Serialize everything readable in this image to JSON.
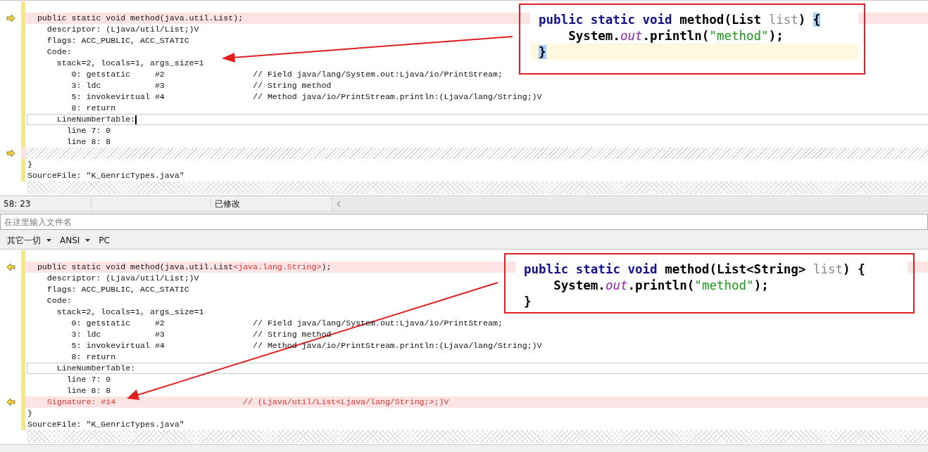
{
  "top_pane": {
    "marker_left": false,
    "lines": [
      {
        "kind": "blank",
        "changed": false
      },
      {
        "kind": "code",
        "changed": true,
        "parts": [
          {
            "text": "  public static void method(java.util.List);",
            "changed": false
          }
        ]
      },
      {
        "kind": "code",
        "changed": false,
        "parts": [
          {
            "text": "    descriptor: (Ljava/util/List;)V",
            "changed": false
          }
        ]
      },
      {
        "kind": "code",
        "changed": false,
        "parts": [
          {
            "text": "    flags: ACC_PUBLIC, ACC_STATIC",
            "changed": false
          }
        ]
      },
      {
        "kind": "code",
        "changed": false,
        "parts": [
          {
            "text": "    Code:",
            "changed": false
          }
        ]
      },
      {
        "kind": "code",
        "changed": false,
        "parts": [
          {
            "text": "      stack=2, locals=1, args_size=1",
            "changed": false
          }
        ]
      },
      {
        "kind": "code",
        "changed": false,
        "parts": [
          {
            "text": "         0: getstatic     #2                  // Field java/lang/System.out:Ljava/io/PrintStream;",
            "changed": false
          }
        ]
      },
      {
        "kind": "code",
        "changed": false,
        "parts": [
          {
            "text": "         3: ldc           #3                  // String method",
            "changed": false
          }
        ]
      },
      {
        "kind": "code",
        "changed": false,
        "parts": [
          {
            "text": "         5: invokevirtual #4                  // Method java/io/PrintStream.println:(Ljava/lang/String;)V",
            "changed": false
          }
        ]
      },
      {
        "kind": "code",
        "changed": false,
        "parts": [
          {
            "text": "         8: return",
            "changed": false
          }
        ]
      },
      {
        "kind": "code",
        "changed": false,
        "boxed": true,
        "cursor": true,
        "parts": [
          {
            "text": "      LineNumberTable:",
            "changed": false
          }
        ]
      },
      {
        "kind": "code",
        "changed": false,
        "parts": [
          {
            "text": "        line 7: 0",
            "changed": false
          }
        ]
      },
      {
        "kind": "code",
        "changed": false,
        "parts": [
          {
            "text": "        line 8: 8",
            "changed": false
          }
        ]
      },
      {
        "kind": "hatch",
        "changed": true
      },
      {
        "kind": "code",
        "changed": false,
        "parts": [
          {
            "text": "}",
            "changed": false
          }
        ]
      },
      {
        "kind": "code",
        "changed": false,
        "parts": [
          {
            "text": "SourceFile: \"K_GenricTypes.java\"",
            "changed": false
          }
        ]
      }
    ],
    "callout": {
      "lines": [
        {
          "current": false,
          "tokens": [
            {
              "kind": "keyword",
              "text": "public static void"
            },
            {
              "kind": "plain",
              "text": " method(List "
            },
            {
              "kind": "param",
              "text": "list"
            },
            {
              "kind": "plain",
              "text": ") "
            },
            {
              "kind": "plain",
              "text": "{",
              "highlighted": true
            }
          ]
        },
        {
          "current": false,
          "tokens": [
            {
              "kind": "plain",
              "text": "    System."
            },
            {
              "kind": "field",
              "text": "out"
            },
            {
              "kind": "plain",
              "text": ".println("
            },
            {
              "kind": "string",
              "text": "\"method\""
            },
            {
              "kind": "plain",
              "text": ");"
            }
          ]
        },
        {
          "current": true,
          "tokens": [
            {
              "kind": "plain",
              "text": "}",
              "highlighted": true
            }
          ]
        }
      ]
    }
  },
  "status_bar": {
    "position": "58: 23",
    "state": "已修改"
  },
  "filename_field": {
    "placeholder": "在这里输入文件名"
  },
  "toolbar": [
    {
      "label": "其它一切",
      "dropdown": true
    },
    {
      "label": "ANSI",
      "dropdown": true
    },
    {
      "label": "PC",
      "dropdown": false
    }
  ],
  "bottom_pane": {
    "marker_left": true,
    "lines": [
      {
        "kind": "blank",
        "changed": false
      },
      {
        "kind": "code",
        "changed": true,
        "parts": [
          {
            "text": "  public static void method(java.util.List",
            "changed": false
          },
          {
            "text": "<java.lang.String>",
            "changed": true
          },
          {
            "text": ");",
            "changed": false
          }
        ]
      },
      {
        "kind": "code",
        "changed": false,
        "parts": [
          {
            "text": "    descriptor: (Ljava/util/List;)V",
            "changed": false
          }
        ]
      },
      {
        "kind": "code",
        "changed": false,
        "parts": [
          {
            "text": "    flags: ACC_PUBLIC, ACC_STATIC",
            "changed": false
          }
        ]
      },
      {
        "kind": "code",
        "changed": false,
        "parts": [
          {
            "text": "    Code:",
            "changed": false
          }
        ]
      },
      {
        "kind": "code",
        "changed": false,
        "parts": [
          {
            "text": "      stack=2, locals=1, args_size=1",
            "changed": false
          }
        ]
      },
      {
        "kind": "code",
        "changed": false,
        "parts": [
          {
            "text": "         0: getstatic     #2                  // Field java/lang/System.out:Ljava/io/PrintStream;",
            "changed": false
          }
        ]
      },
      {
        "kind": "code",
        "changed": false,
        "parts": [
          {
            "text": "         3: ldc           #3                  // String method",
            "changed": false
          }
        ]
      },
      {
        "kind": "code",
        "changed": false,
        "parts": [
          {
            "text": "         5: invokevirtual #4                  // Method java/io/PrintStream.println:(Ljava/lang/String;)V",
            "changed": false
          }
        ]
      },
      {
        "kind": "code",
        "changed": false,
        "parts": [
          {
            "text": "         8: return",
            "changed": false
          }
        ]
      },
      {
        "kind": "code",
        "changed": false,
        "boxed": true,
        "cursor": false,
        "parts": [
          {
            "text": "      LineNumberTable:",
            "changed": false
          }
        ]
      },
      {
        "kind": "code",
        "changed": false,
        "parts": [
          {
            "text": "        line 7: 0",
            "changed": false
          }
        ]
      },
      {
        "kind": "code",
        "changed": false,
        "parts": [
          {
            "text": "        line 8: 8",
            "changed": false
          }
        ]
      },
      {
        "kind": "code",
        "changed": true,
        "parts": [
          {
            "text": "    Signature: #14                          // (Ljava/util/List<Ljava/lang/String;>;)V",
            "changed": true
          }
        ]
      },
      {
        "kind": "code",
        "changed": false,
        "parts": [
          {
            "text": "}",
            "changed": false
          }
        ]
      },
      {
        "kind": "code",
        "changed": false,
        "parts": [
          {
            "text": "SourceFile: \"K_GenricTypes.java\"",
            "changed": false
          }
        ]
      }
    ],
    "callout": {
      "lines": [
        {
          "current": false,
          "tokens": [
            {
              "kind": "keyword",
              "text": "public static void"
            },
            {
              "kind": "plain",
              "text": " method(List<String> "
            },
            {
              "kind": "param",
              "text": "list"
            },
            {
              "kind": "plain",
              "text": ") {"
            }
          ]
        },
        {
          "current": false,
          "tokens": [
            {
              "kind": "plain",
              "text": "    System."
            },
            {
              "kind": "field",
              "text": "out"
            },
            {
              "kind": "plain",
              "text": ".println("
            },
            {
              "kind": "string",
              "text": "\"method\""
            },
            {
              "kind": "plain",
              "text": ");"
            }
          ]
        },
        {
          "current": false,
          "tokens": [
            {
              "kind": "plain",
              "text": "}"
            }
          ]
        }
      ]
    }
  }
}
